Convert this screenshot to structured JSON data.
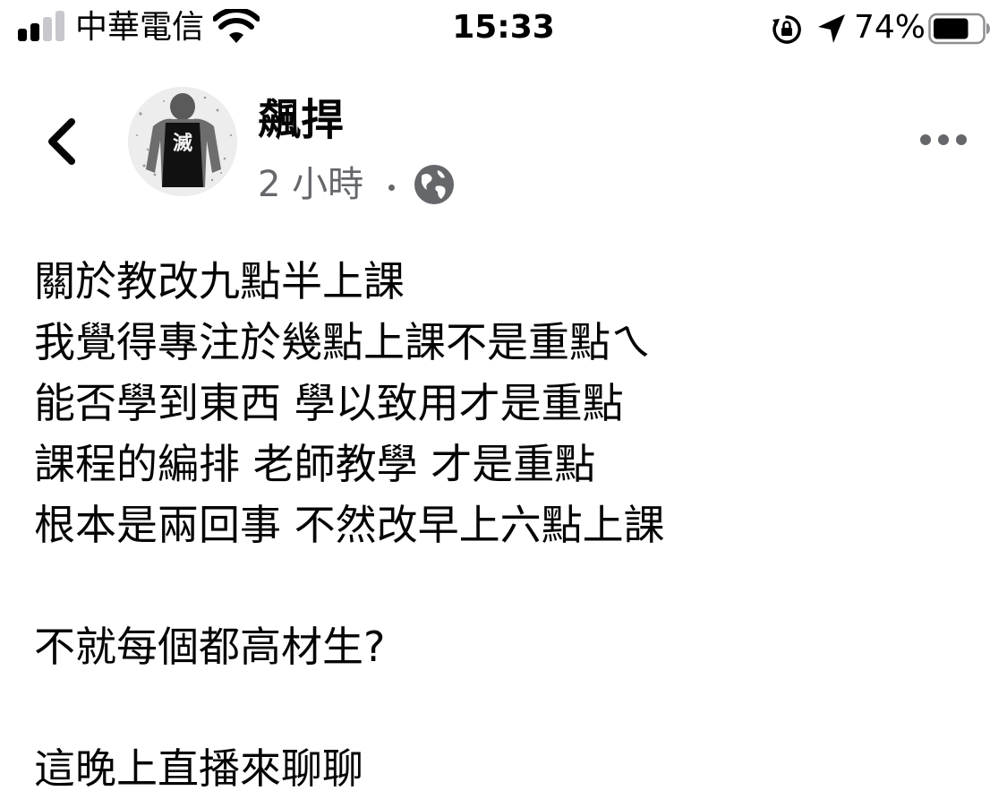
{
  "status_bar": {
    "carrier": "中華電信",
    "time": "15:33",
    "battery_percent": "74%",
    "battery_level": 0.74,
    "signal_bars_active": 2,
    "signal_bars_total": 4,
    "icons": [
      "signal-icon",
      "wifi-icon",
      "rotation-lock-icon",
      "location-arrow-icon",
      "battery-icon"
    ]
  },
  "post": {
    "author": "飆捍",
    "time": "2 小時",
    "privacy_icon": "globe-icon",
    "lines": [
      "關於教改九點半上課",
      "我覺得專注於幾點上課不是重點ㄟ",
      "能否學到東西 學以致用才是重點",
      "課程的編排 老師教學 才是重點",
      "根本是兩回事 不然改早上六點上課",
      "",
      "不就每個都高材生?",
      "",
      "這晚上直播來聊聊"
    ]
  },
  "colors": {
    "text_primary": "#050505",
    "text_secondary": "#65676b",
    "background": "#ffffff"
  }
}
